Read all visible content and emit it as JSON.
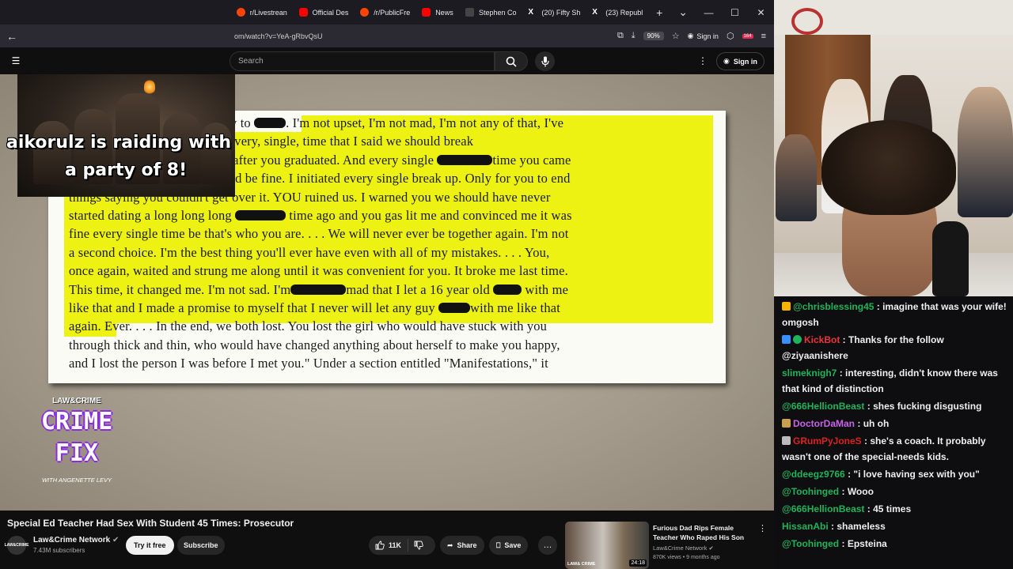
{
  "browser": {
    "tabs": [
      {
        "label": "r/Livestrean",
        "icon": "reddit-icon"
      },
      {
        "label": "Official Des",
        "icon": "youtube-icon"
      },
      {
        "label": "/r/PublicFre",
        "icon": "reddit-icon"
      },
      {
        "label": "News",
        "icon": "youtube-icon"
      },
      {
        "label": "Stephen Co",
        "icon": "page-icon"
      },
      {
        "label": "(20) Fifty Sh",
        "icon": "x-icon"
      },
      {
        "label": "(23) Republ",
        "icon": "x-icon"
      }
    ],
    "url": "om/watch?v=YeA-gRbvQsU",
    "zoom": "90%",
    "signin_label": "Sign in",
    "extension_badge": "164"
  },
  "youtube": {
    "search_placeholder": "Search",
    "signin_label": "Sign in"
  },
  "overlay": {
    "raid_line1": "aikorulz is raiding with",
    "raid_line2": "a party of 8!",
    "logo_top": "LAW&CRIME",
    "logo_word1": "CRIME",
    "logo_word2": "FIX",
    "logo_sub": "WITH ANGENETTE LEVY"
  },
  "document": {
    "lines": [
      {
        "pre": "All I was to you was somebody to ",
        "post": ". I'm not upset, I'm not mad, I'm not any of that, I've"
      },
      {
        "pre": "gone back and screen shotted every, single, time that I said we should break"
      },
      {
        "pre": "up until after the wedding and after you graduated.  And every single ",
        "post": "time you came"
      },
      {
        "pre": "back and convinced me it would be fine.  I initiated every single break up.  Only for you to end"
      },
      {
        "pre": "things saying you couldn't get over it.  YOU ruined us.  I warned you we should have never"
      },
      {
        "pre": "started dating a long long long ",
        "post": " time ago and you gas lit me and convinced me it was"
      },
      {
        "pre": "fine every single time be that's who you are. . . . We will never ever be together again. I'm not"
      },
      {
        "pre": "a second choice.  I'm the best thing you'll ever have even with all of my mistakes. . . . You,"
      },
      {
        "pre": "once again, waited and strung me along until it was convenient for you.  It broke me last time."
      },
      {
        "pre": "This time, it changed me.  I'm not sad.  I'm",
        "post": "mad that I let a 16 year old ",
        "post2": " with me"
      },
      {
        "pre": "like that and I made a promise to myself that I never will let any guy ",
        "post": "with me like that"
      },
      {
        "pre": "again.  Ever. . . . In the end, we both lost.  You lost the girl who would have stuck with you"
      },
      {
        "pre": "through thick and thin, who would have changed anything about herself to make you happy,"
      },
      {
        "pre": "and I lost the person I was before I met you.\"  Under a section entitled \"Manifestations,\" it"
      }
    ]
  },
  "video_info": {
    "title": "Special Ed Teacher Had Sex With Student 45 Times: Prosecutor",
    "channel_avatar": "LAW&CRIME",
    "channel_name": "Law&Crime Network",
    "subscribers": "7.43M subscribers",
    "try_free_label": "Try it free",
    "subscribe_label": "Subscribe",
    "likes": "11K",
    "share_label": "Share",
    "save_label": "Save"
  },
  "related": {
    "title": "Furious Dad Rips Female Teacher Who Raped His Son",
    "channel": "Law&Crime Network",
    "meta": "870K views • 9 months ago",
    "duration": "24:18",
    "thumb_logo": "LAW& CRIME"
  },
  "chat": [
    {
      "user": "@chrisblessing45",
      "color": "#1fb35c",
      "badge": "#f7b500",
      "text": "imagine that was your wife! omgosh"
    },
    {
      "user": "KickBot",
      "color": "#e8343a",
      "badge": "#3a8fff",
      "badge2": "#1fb35c",
      "text": "Thanks for the follow @ziyaanishere"
    },
    {
      "user": "slimeknigh7",
      "color": "#1fb35c",
      "text": "interesting, didn't know there was that kind of distinction"
    },
    {
      "user": "@666HellionBeast",
      "color": "#1fb35c",
      "text": "shes fucking disgusting"
    },
    {
      "user": "DoctorDaMan",
      "color": "#c864e8",
      "badge": "#c8a050",
      "text": "uh oh"
    },
    {
      "user": "GRumPyJoneS",
      "color": "#d8231f",
      "badge": "#bbbbbb",
      "text": "she's a coach. It probably wasn't one of the special-needs kids."
    },
    {
      "user": "@ddeegz9766",
      "color": "#1fb35c",
      "text": "\"i love having sex with you\""
    },
    {
      "user": "@Toohinged",
      "color": "#1fb35c",
      "text": "Wooo"
    },
    {
      "user": "@666HellionBeast",
      "color": "#1fb35c",
      "text": "45 times"
    },
    {
      "user": "HissanAbi",
      "color": "#1fb35c",
      "text": "shameless"
    },
    {
      "user": "@Toohinged",
      "color": "#1fb35c",
      "text": "Epsteina"
    }
  ]
}
